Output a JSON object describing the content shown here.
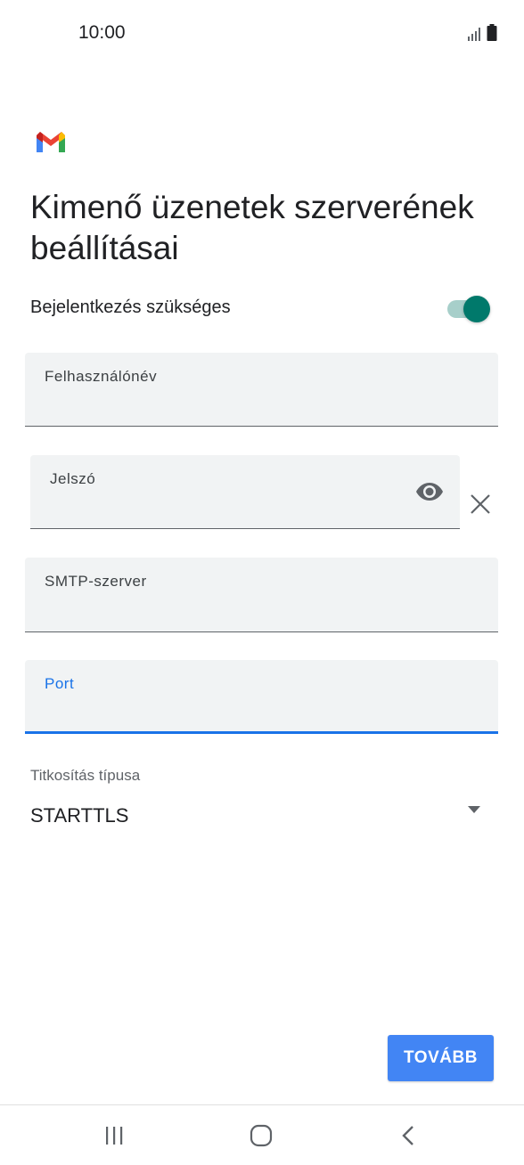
{
  "status_bar": {
    "time": "10:00",
    "icons": [
      "signal-icon",
      "battery-icon"
    ]
  },
  "app": {
    "logo": "gmail-logo",
    "colors": {
      "red": "#ea4335",
      "blue": "#4285f4",
      "green": "#34a853",
      "yellow": "#fbbc04"
    }
  },
  "page": {
    "title": "Kimenő üzenetek szerverének beállításai"
  },
  "login_required": {
    "label": "Bejelentkezés szükséges",
    "enabled": true,
    "accent": "#00796b"
  },
  "fields": {
    "username": {
      "label": "Felhasználónév",
      "value": ""
    },
    "password": {
      "label": "Jelszó",
      "value": "",
      "show_icon": "eye-icon",
      "clear_icon": "close-icon"
    },
    "smtp_server": {
      "label": "SMTP-szerver",
      "value": ""
    },
    "port": {
      "label": "Port",
      "value": "",
      "focused": true,
      "accent": "#1a73e8"
    }
  },
  "encryption": {
    "label": "Titkosítás típusa",
    "selected": "STARTTLS",
    "icon": "dropdown-arrow-icon"
  },
  "actions": {
    "next_label": "TOVÁBB",
    "next_color": "#4285f4"
  },
  "nav_bar": {
    "buttons": [
      "recent-apps-icon",
      "home-icon",
      "back-icon"
    ]
  }
}
